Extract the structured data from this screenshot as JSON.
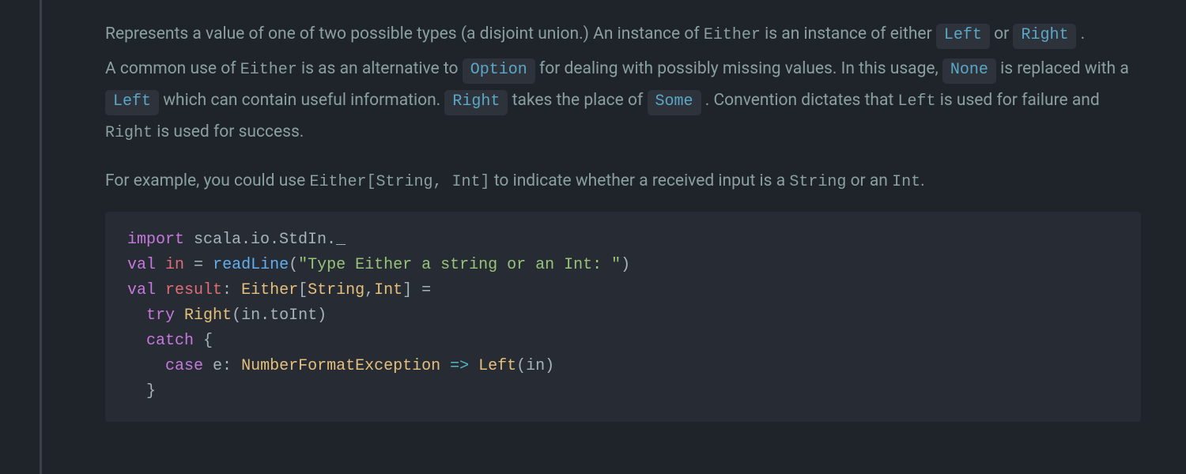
{
  "para1": {
    "t1": "Represents a value of one of two possible types (a disjoint union.) An instance of ",
    "either": "Either",
    "t2": " is an instance of either ",
    "left_link": "Left",
    "t3": " or ",
    "right_link": "Right",
    "t4": " ."
  },
  "para2": {
    "t1": "A common use of ",
    "either": "Either",
    "t2": " is as an alternative to ",
    "option_link": "Option",
    "t3": " for dealing with possibly missing values. In this usage, ",
    "none_link": "None",
    "t4": " is replaced with a ",
    "left_link": "Left",
    "t5": " which can contain useful information. ",
    "right_link": "Right",
    "t6": " takes the place of ",
    "some_link": "Some",
    "t7": " . Convention dictates that ",
    "left_code": "Left",
    "t8": " is used for failure and ",
    "right_code": "Right",
    "t9": " is used for success."
  },
  "para3": {
    "t1": "For example, you could use ",
    "sig": "Either[String, Int]",
    "t2": " to indicate whether a received input is a ",
    "str": "String",
    "t3": " or an ",
    "int": "Int",
    "t4": "."
  },
  "code": {
    "kw_import": "import",
    "import_path": " scala.io.StdIn._",
    "kw_val": "val",
    "name_in": "in",
    "eq1": " = ",
    "fn_readLine": "readLine",
    "lp": "(",
    "str_lit": "\"Type Either a string or an Int: \"",
    "rp": ")",
    "name_result": "result",
    "colon": ": ",
    "sig_type": "Either",
    "br_open": "[",
    "t_string": "String",
    "comma": ",",
    "t_int": "Int",
    "br_close": "]",
    "eq2": " =",
    "kw_try": "try",
    "space": " ",
    "typ_right": "Right",
    "in_toInt": "in.toInt",
    "kw_catch": "catch",
    "brace_open": " {",
    "kw_case": "case",
    "name_e": " e",
    "colon2": ": ",
    "typ_nfe": "NumberFormatException",
    "arrow": " => ",
    "typ_left": "Left",
    "name_in2": "in",
    "brace_close": "}"
  }
}
